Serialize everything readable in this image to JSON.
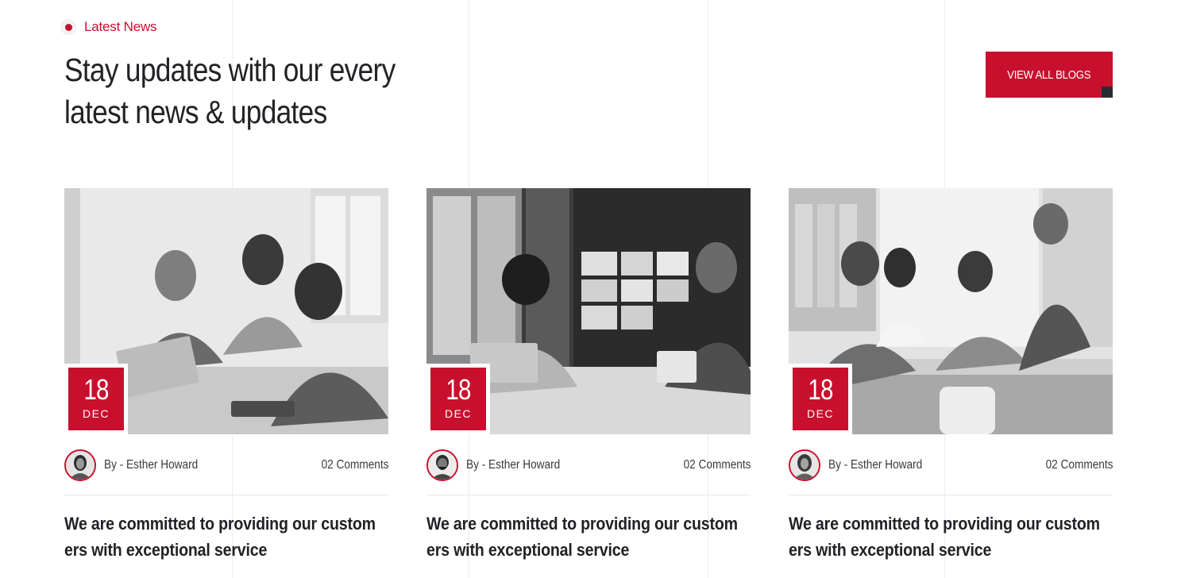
{
  "section": {
    "eyebrow": "Latest News",
    "heading_line1": "Stay updates with our every",
    "heading_line2": "latest news & updates",
    "view_all_label": "VIEW ALL BLOGS"
  },
  "colors": {
    "accent": "#c8102e",
    "dark": "#2b2b33",
    "text": "#222226"
  },
  "posts": [
    {
      "day": "18",
      "month": "DEC",
      "author": "By - Esther Howard",
      "comments": "02 Comments",
      "title": "We are committed to providing our custom ers with exceptional service"
    },
    {
      "day": "18",
      "month": "DEC",
      "author": "By - Esther Howard",
      "comments": "02 Comments",
      "title": "We are committed to providing our custom ers with exceptional service"
    },
    {
      "day": "18",
      "month": "DEC",
      "author": "By - Esther Howard",
      "comments": "02 Comments",
      "title": "We are committed to providing our custom ers with exceptional service"
    }
  ]
}
